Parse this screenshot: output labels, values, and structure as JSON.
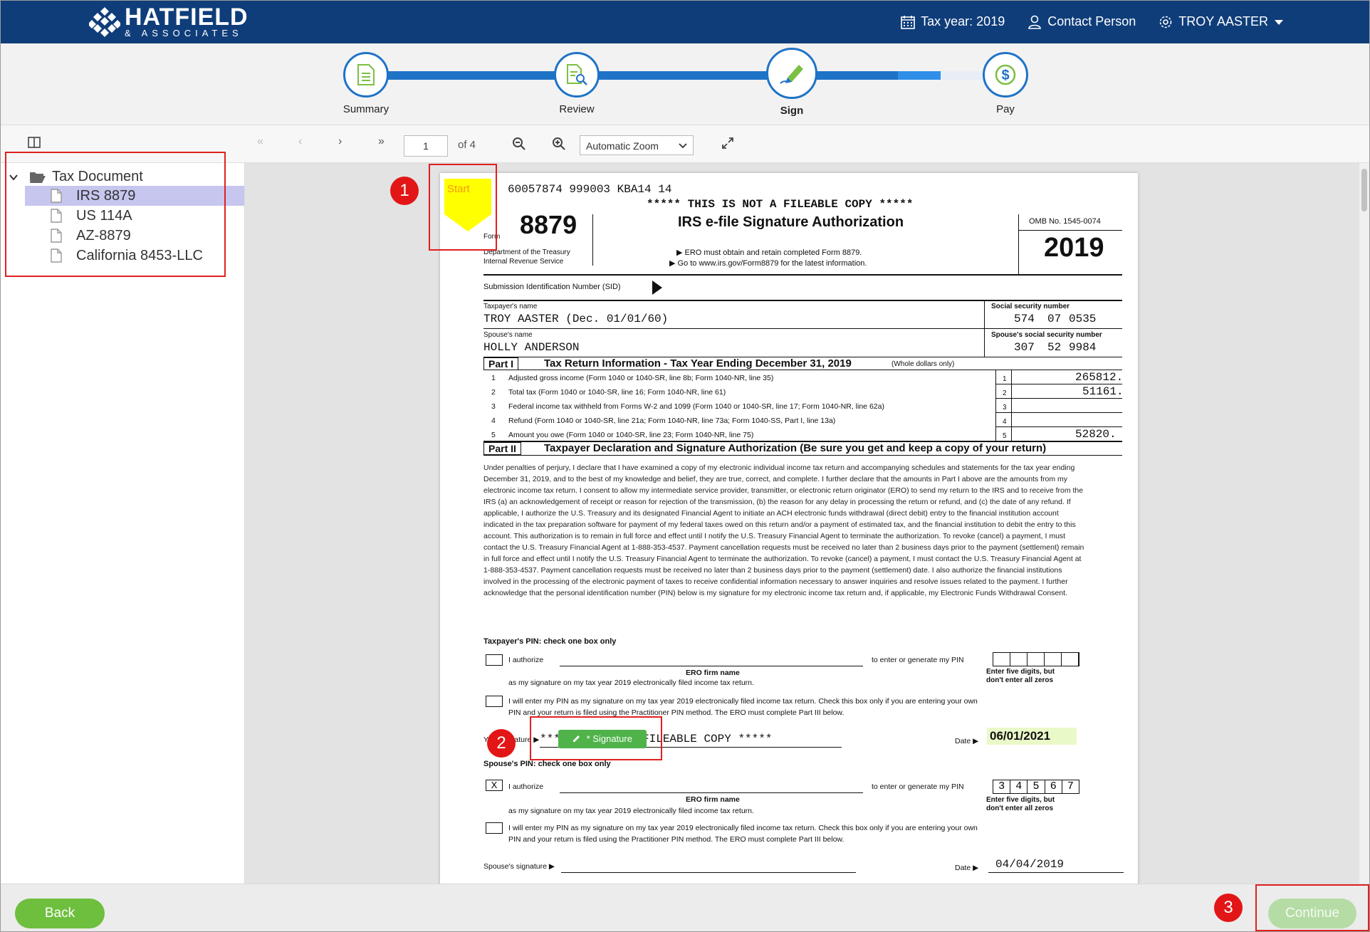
{
  "header": {
    "logo_name": "HATFIELD",
    "logo_sub": "& ASSOCIATES",
    "tax_year": "Tax year: 2019",
    "contact": "Contact Person",
    "user": "TROY AASTER"
  },
  "stepper": {
    "steps": [
      {
        "label": "Summary"
      },
      {
        "label": "Review"
      },
      {
        "label": "Sign"
      },
      {
        "label": "Pay"
      }
    ],
    "active": "Sign"
  },
  "toolbar": {
    "page_number": "1",
    "page_total": "of 4",
    "zoom": "Automatic Zoom"
  },
  "sidebar": {
    "root": "Tax Document",
    "items": [
      {
        "label": "IRS 8879"
      },
      {
        "label": "US 114A"
      },
      {
        "label": "AZ-8879"
      },
      {
        "label": "California 8453-LLC"
      }
    ]
  },
  "document": {
    "start_label": "Start",
    "header_line": "60057874     999003 KBA14          14",
    "not_fileable": "***** THIS IS NOT A FILEABLE COPY *****",
    "form_label": "Form",
    "form_number": "8879",
    "title": "IRS e-file Signature Authorization",
    "omb": "OMB No. 1545-0074",
    "year": "2019",
    "dept1": "Department of the Treasury",
    "dept2": "Internal Revenue Service",
    "ero1": "▶ ERO must obtain and retain completed Form 8879.",
    "ero2": "▶ Go to www.irs.gov/Form8879 for the latest information.",
    "sid_label": "Submission Identification Number (SID)",
    "taxpayer_label": "Taxpayer's name",
    "taxpayer_name": "TROY AASTER (Dec. 01/01/60)",
    "ssn_label": "Social security number",
    "ssn_1": "574",
    "ssn_2": "07",
    "ssn_3": "0535",
    "spouse_label": "Spouse's name",
    "spouse_name": "HOLLY ANDERSON",
    "spouse_ssn_label": "Spouse's social security number",
    "spouse_ssn_1": "307",
    "spouse_ssn_2": "52",
    "spouse_ssn_3": "9984",
    "part1_tag": "Part I",
    "part1_title": "Tax Return Information - Tax Year Ending December 31, 2019",
    "part1_note": "(Whole dollars only)",
    "lines": [
      {
        "n": "1",
        "desc": "Adjusted gross income (Form 1040 or 1040-SR, line 8b; Form 1040-NR, line 35)",
        "box": "1",
        "val": "265812."
      },
      {
        "n": "2",
        "desc": "Total tax (Form 1040 or 1040-SR, line 16; Form 1040-NR, line 61)",
        "box": "2",
        "val": "51161."
      },
      {
        "n": "3",
        "desc": "Federal income tax withheld from Forms W-2 and 1099 (Form 1040 or 1040-SR, line 17; Form 1040-NR, line 62a)",
        "box": "3",
        "val": ""
      },
      {
        "n": "4",
        "desc": "Refund (Form 1040 or 1040-SR, line 21a; Form 1040-NR, line 73a; Form 1040-SS, Part I, line 13a)",
        "box": "4",
        "val": ""
      },
      {
        "n": "5",
        "desc": "Amount you owe (Form 1040 or 1040-SR, line 23; Form 1040-NR, line 75)",
        "box": "5",
        "val": "52820."
      }
    ],
    "part2_tag": "Part II",
    "part2_title": "Taxpayer Declaration and Signature Authorization (Be sure you get and keep a copy of your return)",
    "declaration": "Under penalties of perjury, I declare that I have examined a copy of my electronic individual income tax return and accompanying schedules and statements for the tax year ending December 31, 2019, and to the best of my knowledge and belief, they are true, correct, and complete. I further declare that the amounts in Part I above are the amounts from my electronic income tax return. I consent to allow my intermediate service provider, transmitter, or electronic return originator (ERO) to send my return to the IRS and to receive from the IRS (a) an acknowledgement of receipt or reason for rejection of the transmission, (b) the reason for any delay in processing the return or refund, and (c) the date of any refund. If applicable, I authorize the U.S. Treasury and its designated Financial Agent to initiate an ACH electronic funds withdrawal (direct debit) entry to the financial institution account indicated in the tax preparation software for payment of my federal taxes owed on this return and/or a payment of estimated tax, and the financial institution to debit the entry to this account. This authorization is to remain in full force and effect until I notify the U.S. Treasury Financial Agent to terminate the authorization. To revoke (cancel) a payment, I must contact the U.S. Treasury Financial Agent at 1-888-353-4537. Payment cancellation requests must be received no later than 2 business days prior to the payment (settlement) remain in full force and effect until I notify the U.S. Treasury Financial Agent to terminate the authorization. To revoke (cancel) a payment, I must contact the U.S. Treasury Financial Agent at 1-888-353-4537. Payment cancellation requests must be received no later than 2 business days prior to the payment (settlement) date. I also authorize the financial institutions involved in the processing of the electronic payment of taxes to receive confidential information necessary to answer inquiries and resolve issues related to the payment. I further acknowledge that the personal identification number (PIN) below is my signature for my electronic income tax return and, if applicable, my Electronic Funds Withdrawal Consent.",
    "taxpayer_pin_title": "Taxpayer's PIN: check one box only",
    "i_authorize": "I authorize",
    "to_enter_pin": "to enter or generate my PIN",
    "ero_firm": "ERO firm name",
    "enter_five": "Enter five digits, but",
    "dont_zeros": "don't enter all zeros",
    "as_my_sig": "as my signature on my tax year 2019 electronically filed income tax return.",
    "will_enter": "I will enter my PIN as my signature on my tax year 2019 electronically filed income tax return. Check this box only if you are entering your own",
    "pin_and": "PIN and your return is filed using the Practitioner PIN method. The ERO must complete Part III below.",
    "your_sig_label": "Your signature ▶",
    "sig_overlay_text": "***** IS NOT A FILEABLE COPY *****",
    "signature_button": "* Signature",
    "date_label": "Date ▶",
    "taxpayer_date": "06/01/2021",
    "spouse_pin_title": "Spouse's PIN: check one box only",
    "spouse_check": "X",
    "spouse_pin": [
      "3",
      "4",
      "5",
      "6",
      "7"
    ],
    "spouse_sig_label": "Spouse's signature ▶",
    "spouse_date": "04/04/2019"
  },
  "annotations": [
    "1",
    "2",
    "3"
  ],
  "footer": {
    "back": "Back",
    "continue": "Continue"
  },
  "colors": {
    "header_bg": "#0f3d7a",
    "accent_blue": "#1f73c6",
    "green": "#6ebf3e",
    "annotation_red": "#e02020",
    "start_yellow": "#ffff00",
    "date_highlight": "#eaf9c8"
  }
}
